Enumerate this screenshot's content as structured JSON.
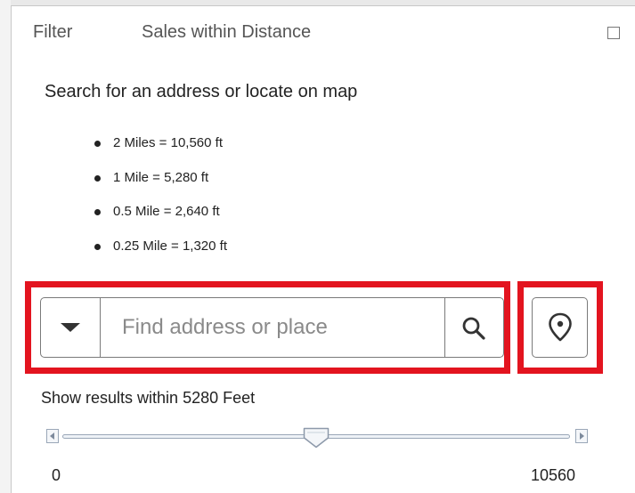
{
  "tabs": [
    {
      "label": "Filter"
    },
    {
      "label": "Sales within Distance"
    }
  ],
  "instructions": "Search for an address or locate on map",
  "distances": [
    {
      "label": "2 Miles = 10,560 ft"
    },
    {
      "label": "1 Mile = 5,280 ft"
    },
    {
      "label": "0.5 Mile = 2,640 ft"
    },
    {
      "label": "0.25 Mile  = 1,320 ft"
    }
  ],
  "search": {
    "value": "",
    "placeholder": "Find address or place"
  },
  "results_label": "Show results within 5280 Feet",
  "slider": {
    "min": "0",
    "max": "10560",
    "value": 5280
  },
  "colors": {
    "highlight": "#e3141f",
    "border": "#7a7a7a"
  },
  "icons": {
    "dropdown": "chevron-down-icon",
    "search": "search-icon",
    "locate": "location-pin-icon",
    "maximize": "maximize-icon"
  }
}
